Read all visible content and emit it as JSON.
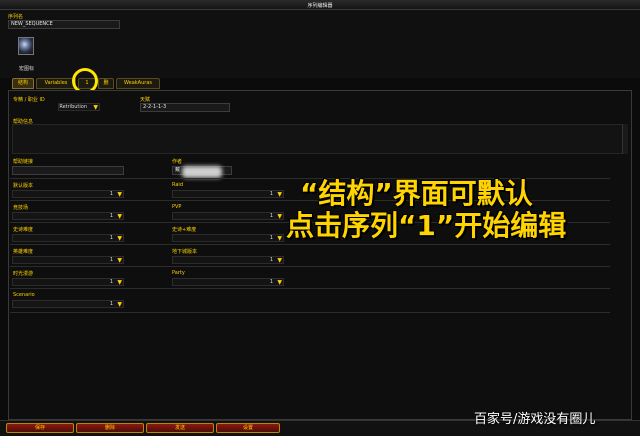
{
  "window": {
    "title": "序列编辑器"
  },
  "header": {
    "sequence_name_label": "序列名",
    "sequence_name": "NEW_SEQUENCE",
    "macro_icon_label": "宏图标"
  },
  "tabs": [
    {
      "label": "结构"
    },
    {
      "label": "Variables"
    },
    {
      "label": "1"
    },
    {
      "label": "删"
    },
    {
      "label": "WeakAuras"
    }
  ],
  "form": {
    "spec_label": "专精 / 职业 ID",
    "spec_value": "Retribution",
    "talent_label": "天赋",
    "talent_value": "2-2-1-1-3",
    "help_info_label": "帮助信息",
    "help_link_label": "帮助链接",
    "author_label": "作者",
    "author_value": "戴",
    "default_version_label": "默认版本",
    "default_version_value": "1",
    "raid_label": "Raid",
    "raid_value": "1",
    "dungeon_label": "竞技场",
    "dungeon_value": "1",
    "pvp_label": "PVP",
    "pvp_value": "1",
    "mythic_label": "史诗难度",
    "mythic_value": "1",
    "mythicplus_label": "史诗+难度",
    "mythicplus_value": "1",
    "heroic_label": "英雄难度",
    "heroic_value": "1",
    "delve_label": "地下城版本",
    "delve_value": "1",
    "timewalk_label": "时光漫游",
    "timewalk_value": "1",
    "party_label": "Party",
    "party_value": "1",
    "scenario_label": "Scenario",
    "scenario_value": "1"
  },
  "overlay": {
    "line1": "“结构”界面可默认",
    "line2": "点击序列“1”开始编辑"
  },
  "footer": {
    "save": "保存",
    "delete": "删除",
    "send": "发送",
    "settings": "设置"
  },
  "watermark": "百家号/游戏没有圈儿",
  "colors": {
    "label_gold": "#ffd100",
    "overlay_yellow": "#ffd400",
    "button_red": "#8a1a10"
  }
}
